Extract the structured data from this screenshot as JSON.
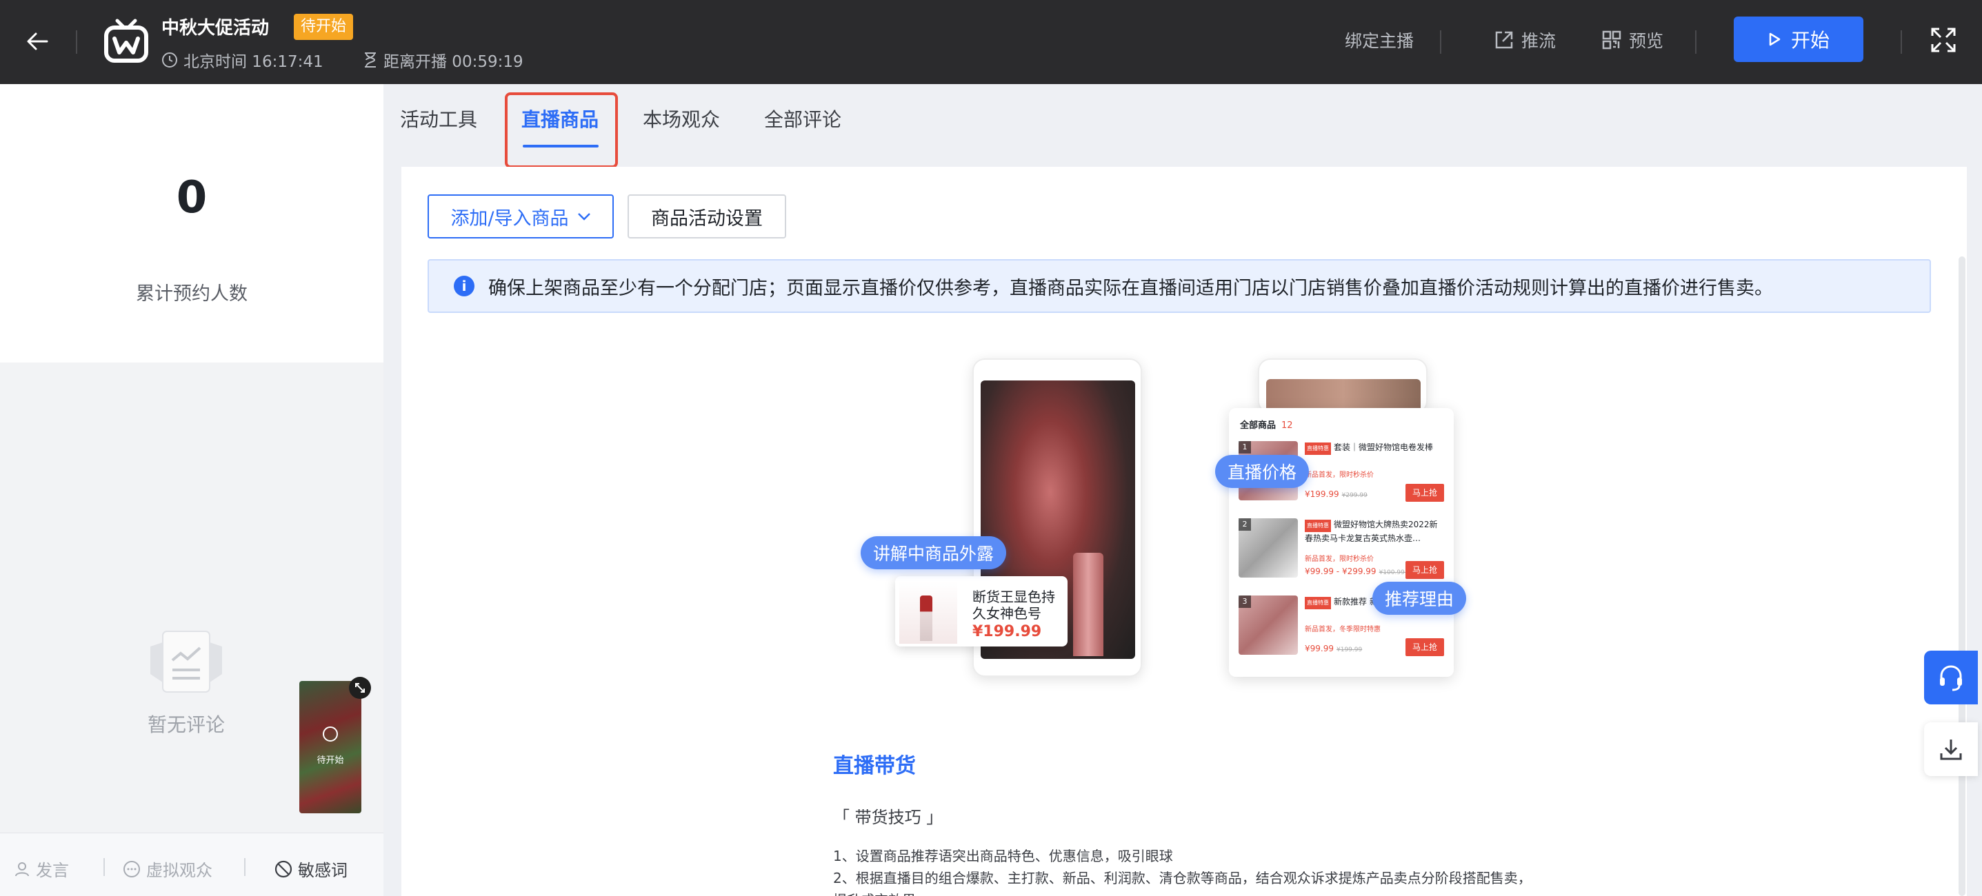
{
  "header": {
    "title": "中秋大促活动",
    "status": "待开始",
    "beijing_time": "北京时间 16:17:41",
    "countdown": "距离开播 00:59:19",
    "bind_host": "绑定主播",
    "push_stream": "推流",
    "preview": "预览",
    "start": "开始"
  },
  "left": {
    "reservation_count": "0",
    "reservation_label": "累计预约人数",
    "empty_comments": "暂无评论",
    "mini_status": "待开始",
    "bottom": {
      "speak": "发言",
      "virtual_audience": "虚拟观众",
      "sensitive_words": "敏感词"
    }
  },
  "tabs": [
    {
      "label": "活动工具"
    },
    {
      "label": "直播商品"
    },
    {
      "label": "本场观众"
    },
    {
      "label": "全部评论"
    }
  ],
  "active_tab": "直播商品",
  "content": {
    "add_import_button": "添加/导入商品",
    "activity_settings_button": "商品活动设置",
    "notice": "确保上架商品至少有一个分配门店；页面显示直播价仅供参考，直播商品实际在直播间适用门店以门店销售价叠加直播价活动规则计算出的直播价进行售卖。",
    "illustration": {
      "bubble_explaining": "讲解中商品外露",
      "bubble_live_price": "直播价格",
      "bubble_reason": "推荐理由",
      "card_name": "断货王显色持久女神色号",
      "card_price": "¥199.99",
      "panel_title": "全部商品",
      "panel_count": "12",
      "products": [
        {
          "rank": "1",
          "badge": "直播特惠",
          "name": "套装｜微盟好物馆电卷发棒",
          "promo": "新品首发，限时秒杀价",
          "price": "¥199.99",
          "orig": "¥299.99",
          "buy": "马上抢"
        },
        {
          "rank": "2",
          "badge": "直播特惠",
          "name": "微盟好物馆大牌热卖2022新春热卖马卡龙复古英式热水壶…",
          "promo": "新品首发，限时秒杀价",
          "price": "¥99.99 - ¥299.99",
          "orig": "¥100.99 - ¥400.99",
          "buy": "马上抢"
        },
        {
          "rank": "3",
          "badge": "直播特惠",
          "name": "新款推荐 新款推荐全棉浴巾",
          "promo": "新品首发，冬季限时特惠",
          "price": "¥99.99",
          "orig": "¥199.99",
          "buy": "马上抢"
        }
      ]
    },
    "section_title": "直播带货",
    "sub_title": "「 带货技巧 」",
    "tips": [
      "1、设置商品推荐语突出商品特色、优惠信息，吸引眼球",
      "2、根据直播目的组合爆款、主打款、新品、利润款、清仓款等商品，结合观众诉求提炼产品卖点分阶段搭配售卖，",
      "提升成交效果"
    ]
  },
  "colors": {
    "topbar": "#2b2b2d",
    "primary": "#2d6df6",
    "status": "#f6a623",
    "highlight": "#e74c3c"
  }
}
